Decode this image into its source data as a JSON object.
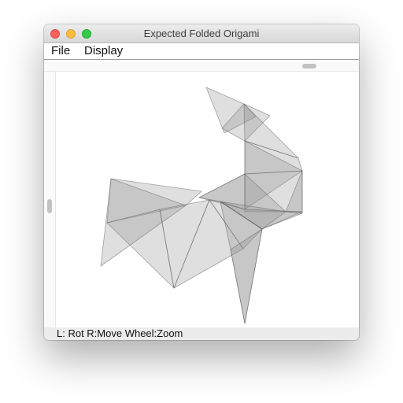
{
  "window": {
    "title": "Expected Folded Origami"
  },
  "menu": {
    "items": [
      {
        "label": "File"
      },
      {
        "label": "Display"
      }
    ]
  },
  "status": {
    "hint": "L: Rot R:Move Wheel:Zoom"
  },
  "colors": {
    "close": "#fc605c",
    "minimize": "#fdbc40",
    "zoom": "#34c84a",
    "facet_fill": "#8a8a8a",
    "facet_stroke": "#5e5e5e"
  }
}
